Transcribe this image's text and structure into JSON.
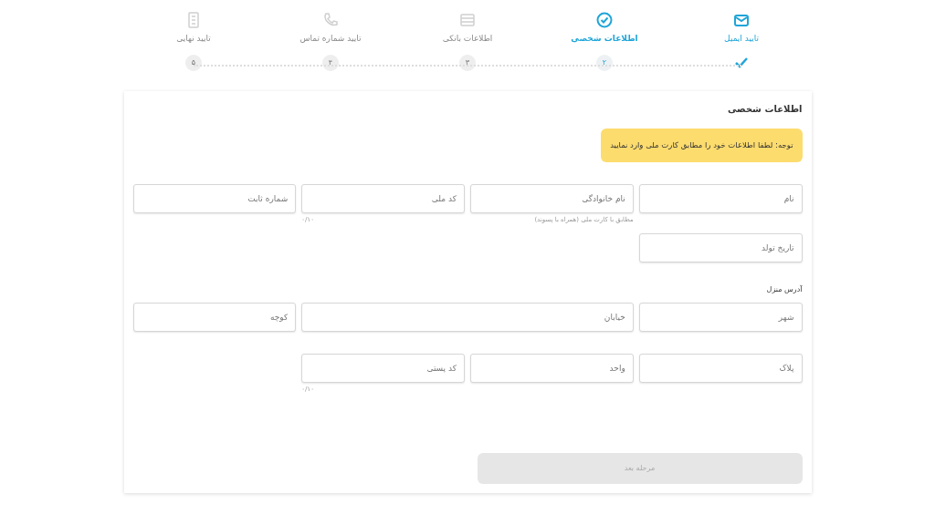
{
  "steps": [
    {
      "label": "تایید ایمیل",
      "completed": true,
      "selected": false
    },
    {
      "label": "اطلاعات شخصی",
      "completed": false,
      "selected": true,
      "number": "۲"
    },
    {
      "label": "اطلاعات بانکی",
      "completed": false,
      "selected": false,
      "number": "۳"
    },
    {
      "label": "تایید شماره تماس",
      "completed": false,
      "selected": false,
      "number": "۴"
    },
    {
      "label": "تایید نهایی",
      "completed": false,
      "selected": false,
      "number": "۵"
    }
  ],
  "form": {
    "title": "اطلاعات شخصی",
    "notice": "توجه: لطفا اطلاعات خود را مطابق کارت ملی وارد نمایید",
    "personal_rows": [
      [
        {
          "placeholder": "نام"
        },
        {
          "placeholder": "نام خانوادگی",
          "hint": "مطابق با کارت ملی (همراه با پسوند)"
        },
        {
          "placeholder": "کد ملی",
          "counter": "۰/۱۰"
        },
        {
          "placeholder": "شماره ثابت"
        }
      ],
      [
        {
          "placeholder": "تاریخ تولد"
        }
      ]
    ],
    "address_title": "آدرس منزل",
    "address_rows": [
      [
        {
          "placeholder": "شهر"
        },
        {
          "placeholder": "خیابان",
          "wide": true
        },
        {
          "placeholder": "کوچه"
        }
      ],
      [
        {
          "placeholder": "پلاک"
        },
        {
          "placeholder": "واحد"
        },
        {
          "placeholder": "کد پستی",
          "counter": "۰/۱۰"
        }
      ]
    ],
    "submit": {
      "label": "مرحله بعد",
      "disabled": true
    }
  }
}
